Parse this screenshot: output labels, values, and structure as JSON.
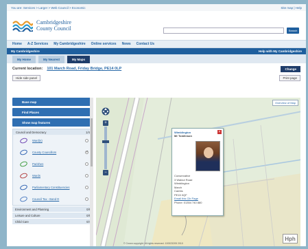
{
  "topbar": {
    "breadcrumb": "You are: Services > Larger > Web Council > Economic",
    "right_links": "Site map | Help"
  },
  "header": {
    "org_line1": "Cambridgeshire",
    "org_line2": "County Council",
    "search_placeholder": "",
    "search_label": "Search"
  },
  "nav": {
    "items": [
      "Home",
      "A-Z Services",
      "My Cambridgeshire",
      "Online services",
      "News",
      "Contact Us"
    ]
  },
  "section_bar": {
    "title": "My Cambridgeshire",
    "right_link": "Help with My Cambridgeshire"
  },
  "tabs": [
    {
      "label": "My Home"
    },
    {
      "label": "My Nearest"
    },
    {
      "label": "My Maps"
    }
  ],
  "location": {
    "label": "Current location:",
    "address": "101 March Road, Friday Bridge, PE14 0LP",
    "change_label": "Change"
  },
  "toolbar": {
    "left_btn": "Hide side panel",
    "right_btn": "Print page"
  },
  "sidebar": {
    "buttons": [
      "Base map",
      "Find Places",
      "Show map features"
    ],
    "group_title": "Council and Democracy",
    "group_count": "1/4",
    "layers": [
      {
        "label": "Ward(s)",
        "color": "#6a3fb0",
        "checked": false
      },
      {
        "label": "County Councillors",
        "color": "#2a5fb0",
        "checked": true
      },
      {
        "label": "Parishes",
        "color": "#3a9a3a",
        "checked": false
      },
      {
        "label": "Wards",
        "color": "#b03a3a",
        "checked": false
      },
      {
        "label": "Parliamentary Constituencies",
        "color": "#2a5fb0",
        "checked": false
      },
      {
        "label": "Council Tax - Band D",
        "color": "#4a7ac0",
        "checked": false
      }
    ],
    "footer_groups": [
      {
        "label": "Environment and Planning",
        "count": "0/8"
      },
      {
        "label": "Leisure and Culture",
        "count": "0/6"
      },
      {
        "label": "Child Care",
        "count": "0/4"
      }
    ]
  },
  "map": {
    "overview_label": "Overview of Map",
    "copyright": "© Crown copyright. All rights reserved. 100023205 2010"
  },
  "popup": {
    "title": "Wimblington",
    "name": "Mr Tomlinson",
    "lines": [
      "Conservative",
      "3 Walnut Road",
      "Wimblington",
      "March",
      "Cambs",
      "PE15 0QF",
      "Phone: 01354 740 880"
    ],
    "link": "Email this Cllr Page"
  },
  "footer_logo": "Hph"
}
